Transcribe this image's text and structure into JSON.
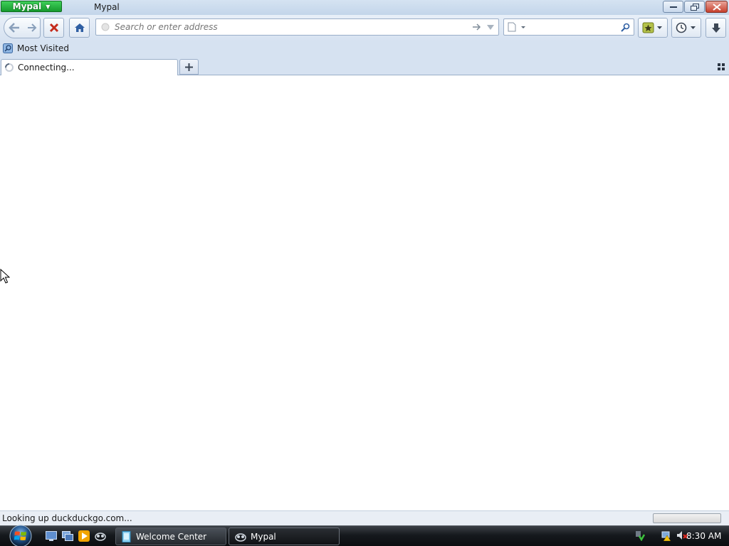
{
  "titlebar": {
    "app_button_label": "Mypal",
    "window_title": "Mypal"
  },
  "navbar": {
    "url_placeholder": "Search or enter address",
    "url_value": "",
    "search_value": ""
  },
  "bookmarks": {
    "items": [
      {
        "label": "Most Visited",
        "icon": "most-visited-folder-icon"
      }
    ]
  },
  "tabs": [
    {
      "label": "Connecting...",
      "state": "loading",
      "icon": "loading-spinner-icon"
    }
  ],
  "status": {
    "text": "Looking up duckduckgo.com..."
  },
  "taskbar": {
    "buttons": [
      {
        "label": "Welcome Center",
        "active": false
      },
      {
        "label": "Mypal",
        "active": true
      }
    ],
    "clock": "8:30 AM"
  },
  "colors": {
    "app_button": "#22b43c",
    "toolbar": "#d6e2f1",
    "stop_red": "#c42b1c",
    "home_blue": "#2f5fa3",
    "taskbar": "#16191d"
  }
}
